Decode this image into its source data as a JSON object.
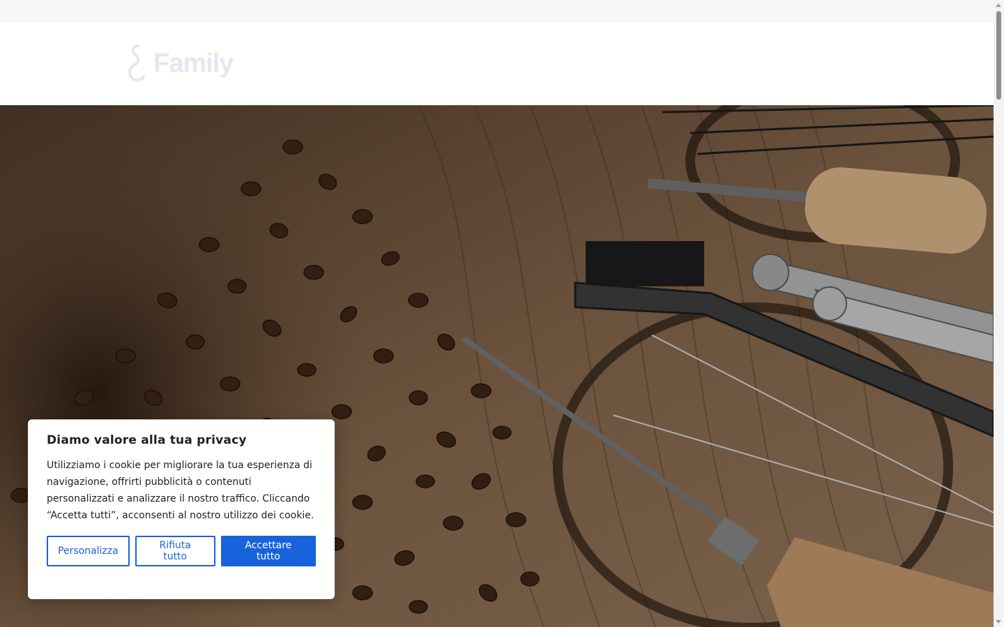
{
  "topbar": {
    "text": ""
  },
  "header": {
    "logo_text": "Family"
  },
  "cookie_banner": {
    "title": "Diamo valore alla tua privacy",
    "body": "Utilizziamo i cookie per migliorare la tua esperienza di navigazione, offrirti pubblicità o contenuti personalizzati e analizzare il nostro traffico. Cliccando “Accetta tutti”, acconsenti al nostro utilizzo dei cookie.",
    "customize_label": "Personalizza",
    "reject_label": "Rifiuta tutto",
    "accept_label": "Accettare tutto"
  },
  "colors": {
    "accent": "#1863dc",
    "text": "#212121",
    "hero_overlay": "#3b2a1e"
  }
}
